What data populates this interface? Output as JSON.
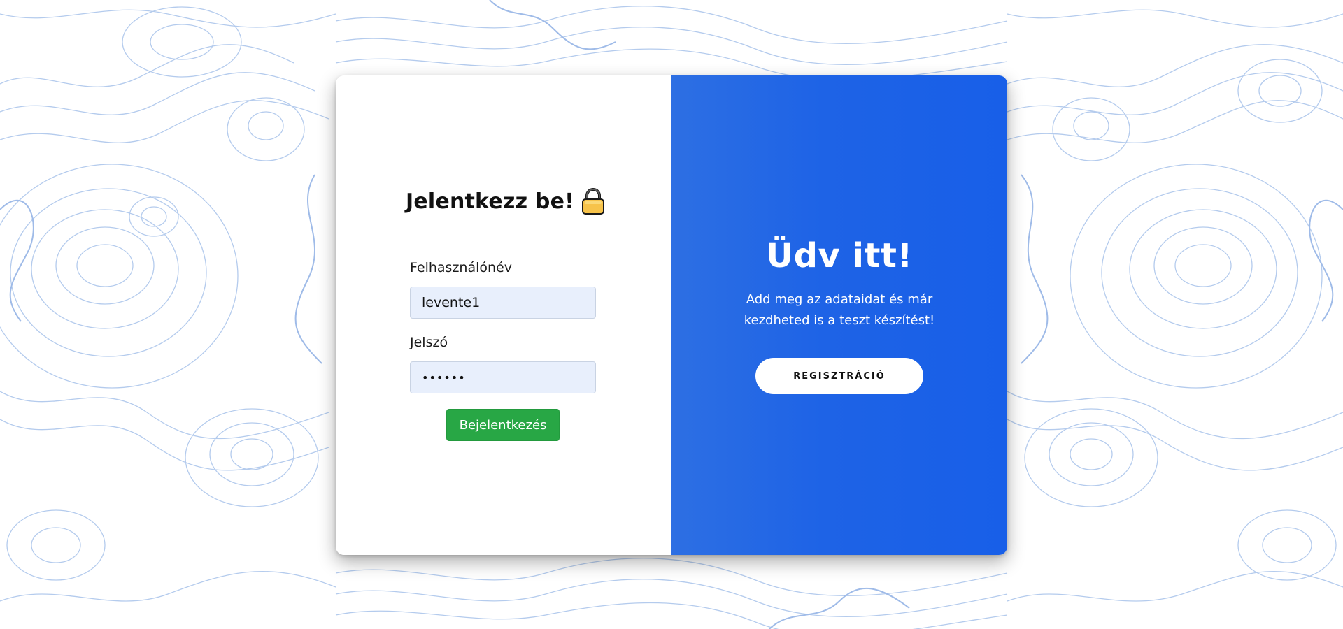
{
  "login": {
    "title": "Jelentkezz be!",
    "username_label": "Felhasználónév",
    "username_value": "levente1",
    "password_label": "Jelszó",
    "password_value": "••••••",
    "submit_label": "Bejelentkezés"
  },
  "welcome": {
    "title": "Üdv itt!",
    "text": "Add meg az adataidat és már kezdheted is a teszt készítést!",
    "register_label": "REGISZTRÁCIÓ"
  },
  "icons": {
    "title_icon": "lock-icon"
  },
  "colors": {
    "accent_blue": "#1e63e6",
    "login_button": "#28a745",
    "input_background": "#e8effc",
    "background_lines": "#aac4ea"
  }
}
